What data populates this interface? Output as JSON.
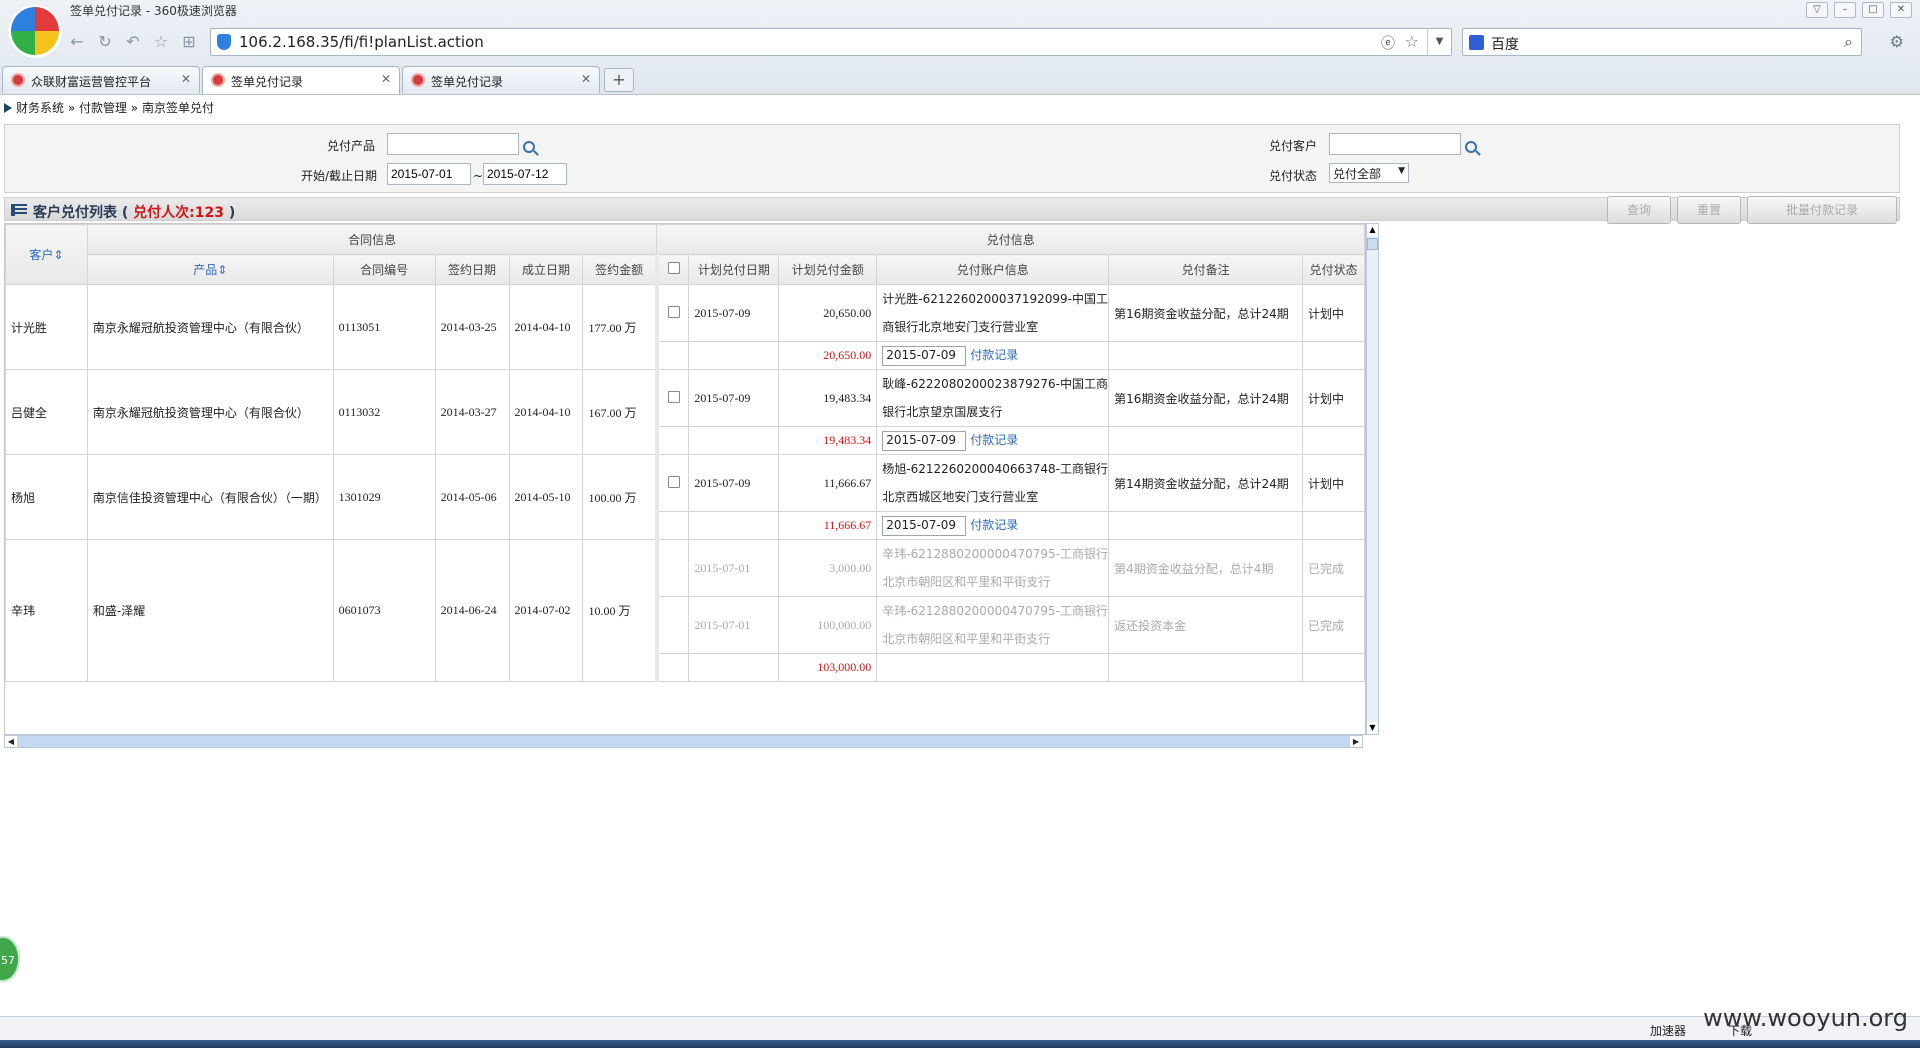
{
  "window": {
    "title": "签单兑付记录 - 360极速浏览器",
    "url": "106.2.168.35/fi/fi!planList.action",
    "search_engine": "百度"
  },
  "tabs": [
    {
      "label": "众联财富运营管控平台",
      "active": false
    },
    {
      "label": "签单兑付记录",
      "active": true
    },
    {
      "label": "签单兑付记录",
      "active": false
    }
  ],
  "breadcrumb": "财务系统 » 付款管理 » 南京签单兑付",
  "filters": {
    "product_label": "兑付产品",
    "product_value": "",
    "customer_label": "兑付客户",
    "customer_value": "",
    "date_label": "开始/截止日期",
    "start_date": "2015-07-01",
    "date_sep": "~",
    "end_date": "2015-07-12",
    "status_label": "兑付状态",
    "status_value": "兑付全部"
  },
  "list": {
    "title": "客户兑付列表 (",
    "count_label": "兑付人次:123",
    "close_paren": " )",
    "buttons": {
      "query": "查询",
      "reset": "重置",
      "batch": "批量付款记录"
    }
  },
  "table": {
    "group_contract": "合同信息",
    "group_payment": "兑付信息",
    "headers": {
      "customer": "客户",
      "product": "产品",
      "contract_no": "合同编号",
      "sign_date": "签约日期",
      "start_date": "成立日期",
      "amount": "签约金额",
      "plan_date": "计划兑付日期",
      "plan_amount": "计划兑付金额",
      "account": "兑付账户信息",
      "remark": "兑付备注",
      "status": "兑付状态"
    },
    "pay_link": "付款记录",
    "rows": [
      {
        "customer": "计光胜",
        "product": "南京永耀冠航投资管理中心（有限合伙）",
        "contract_no": "0113051",
        "sign_date": "2014-03-25",
        "start_date": "2014-04-10",
        "amount": "177.00 万",
        "plans": [
          {
            "date": "2015-07-09",
            "amount": "20,650.00",
            "account": "计光胜-6212260200037192099-中国工商银行北京地安门支行营业室",
            "remark": "第16期资金收益分配，总计24期",
            "status": "计划中",
            "done": false
          }
        ],
        "total": "20,650.00",
        "pay_date": "2015-07-09"
      },
      {
        "customer": "吕健全",
        "product": "南京永耀冠航投资管理中心（有限合伙）",
        "contract_no": "0113032",
        "sign_date": "2014-03-27",
        "start_date": "2014-04-10",
        "amount": "167.00 万",
        "plans": [
          {
            "date": "2015-07-09",
            "amount": "19,483.34",
            "account": "耿峰-6222080200023879276-中国工商银行北京望京国展支行",
            "remark": "第16期资金收益分配，总计24期",
            "status": "计划中",
            "done": false
          }
        ],
        "total": "19,483.34",
        "pay_date": "2015-07-09"
      },
      {
        "customer": "杨旭",
        "product": "南京信佳投资管理中心（有限合伙）（一期）",
        "contract_no": "1301029",
        "sign_date": "2014-05-06",
        "start_date": "2014-05-10",
        "amount": "100.00 万",
        "plans": [
          {
            "date": "2015-07-09",
            "amount": "11,666.67",
            "account": "杨旭-6212260200040663748-工商银行北京西城区地安门支行营业室",
            "remark": "第14期资金收益分配，总计24期",
            "status": "计划中",
            "done": false
          }
        ],
        "total": "11,666.67",
        "pay_date": "2015-07-09"
      },
      {
        "customer": "辛玮",
        "product": "和盛-泽耀",
        "contract_no": "0601073",
        "sign_date": "2014-06-24",
        "start_date": "2014-07-02",
        "amount": "10.00 万",
        "plans": [
          {
            "date": "2015-07-01",
            "amount": "3,000.00",
            "account": "辛玮-6212880200000470795-工商银行北京市朝阳区和平里和平街支行",
            "remark": "第4期资金收益分配，总计4期",
            "status": "已完成",
            "done": true
          },
          {
            "date": "2015-07-01",
            "amount": "100,000.00",
            "account": "辛玮-6212880200000470795-工商银行北京市朝阳区和平里和平街支行",
            "remark": "返还投资本金",
            "status": "已完成",
            "done": true
          }
        ],
        "total": "103,000.00",
        "pay_date": ""
      }
    ]
  },
  "status_bar": {
    "accelerator": "加速器",
    "download": "下载"
  },
  "badge": "57",
  "watermark": "www.wooyun.org",
  "colors": {
    "red_amount": "#e01010",
    "link": "#2a6ac0",
    "header_bg": "#e8e8e8"
  }
}
